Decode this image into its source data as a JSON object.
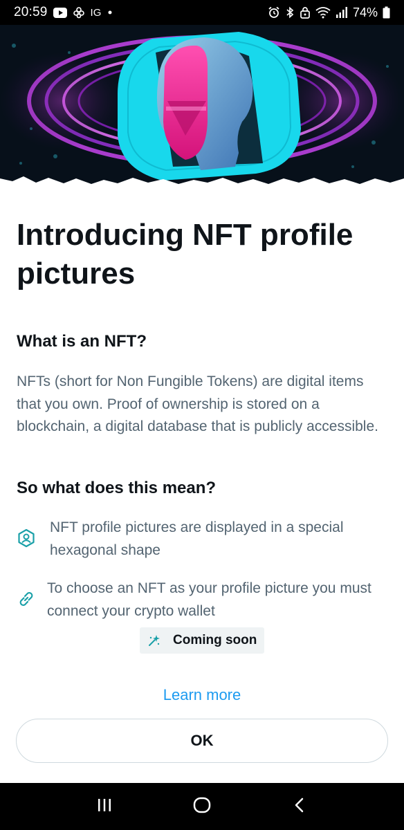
{
  "status_bar": {
    "time": "20:59",
    "app_label": "IG",
    "battery_percent": "74%",
    "icons": [
      "youtube-icon",
      "pinwheel-icon",
      "dot-icon",
      "alarm-icon",
      "bluetooth-icon",
      "lock-icon",
      "wifi-icon",
      "signal-icon",
      "battery-icon"
    ]
  },
  "hero": {
    "description_icon": "nft-hero-illustration",
    "colors": {
      "cyan": "#18d8ec",
      "magenta": "#ee1c8e",
      "purple": "#7a2fbf",
      "dark": "#07101a"
    }
  },
  "main": {
    "title": "Introducing NFT profile pictures",
    "what_heading": "What is an NFT?",
    "what_body": "NFTs (short for Non Fungible Tokens) are digital items that you own. Proof of ownership is stored on a blockchain, a digital database that is publicly accessible.",
    "meaning_heading": "So what does this mean?",
    "features": [
      {
        "icon": "hexagon-avatar-icon",
        "text": "NFT profile pictures are displayed in a special hexagonal shape"
      },
      {
        "icon": "link-icon",
        "text": "To choose an NFT as your profile picture you must connect your crypto wallet"
      }
    ],
    "badge": {
      "icon": "sparkle-icon",
      "label": "Coming soon"
    },
    "learn_more": "Learn more",
    "ok_label": "OK"
  },
  "nav_bar": {
    "buttons": [
      "recents-icon",
      "home-icon",
      "back-icon"
    ]
  },
  "colors": {
    "accent": "#1d9bf0",
    "text_primary": "#0f1419",
    "text_secondary": "#536471",
    "icon_teal": "#1aa0a8",
    "badge_bg": "#eff3f4",
    "button_border": "#cfd9de"
  }
}
